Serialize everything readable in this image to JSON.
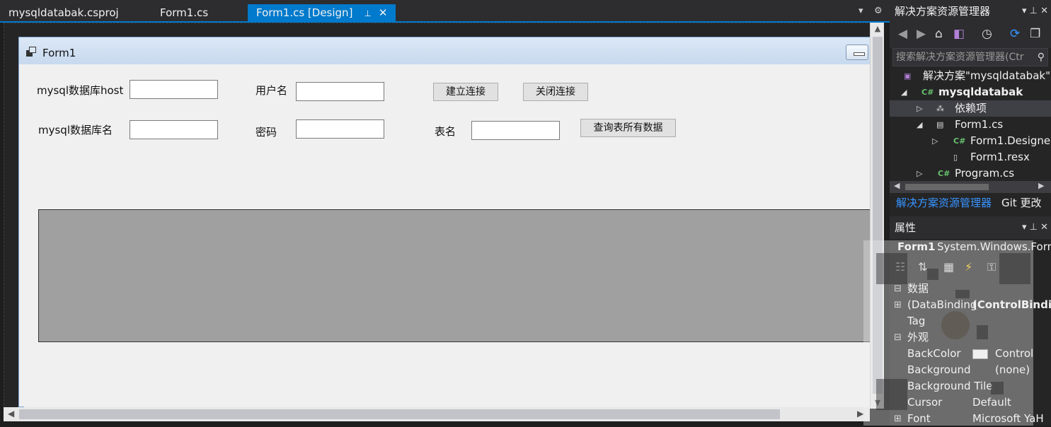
{
  "tabs": [
    {
      "label": "mysqldatabak.csproj",
      "active": false
    },
    {
      "label": "Form1.cs",
      "active": false
    },
    {
      "label": "Form1.cs [Design]",
      "active": true
    }
  ],
  "tab_controls": {
    "pin": "⊥",
    "close": "✕",
    "dropdown": "▾",
    "gear": "⚙"
  },
  "form": {
    "title": "Form1",
    "labels": {
      "host": "mysql数据库host",
      "user": "用户名",
      "dbname": "mysql数据库名",
      "password": "密码",
      "table": "表名"
    },
    "inputs": {
      "host": "",
      "user": "",
      "dbname": "",
      "password": "",
      "table": ""
    },
    "buttons": {
      "connect": "建立连接",
      "disconnect": "关闭连接",
      "query": "查询表所有数据"
    }
  },
  "solution_explorer": {
    "title": "解决方案资源管理器",
    "search_placeholder": "搜索解决方案资源管理器(Ctr",
    "tree": [
      {
        "label": "解决方案\"mysqldatabak\"(",
        "icon": "solution-icon",
        "level": 0
      },
      {
        "label": "mysqldatabak",
        "icon": "csharp-project-icon",
        "level": 0,
        "bold": true,
        "expanded": true
      },
      {
        "label": "依赖项",
        "icon": "dependencies-icon",
        "level": 1,
        "selected": true
      },
      {
        "label": "Form1.cs",
        "icon": "form-icon",
        "level": 1,
        "expanded": true
      },
      {
        "label": "Form1.Designe",
        "icon": "csharp-file-icon",
        "level": 2
      },
      {
        "label": "Form1.resx",
        "icon": "resource-file-icon",
        "level": 2
      },
      {
        "label": "Program.cs",
        "icon": "csharp-file-icon",
        "level": 1
      }
    ],
    "bottom_tabs": [
      "解决方案资源管理器",
      "Git 更改"
    ]
  },
  "properties": {
    "title": "属性",
    "object_name": "Form1",
    "object_type": "System.Windows.Forr",
    "rows": [
      {
        "kind": "category",
        "name": "数据"
      },
      {
        "kind": "prop",
        "name": "(DataBinding",
        "value": "(ControlBindir",
        "expandable": true,
        "bold_value": true
      },
      {
        "kind": "prop",
        "name": "Tag",
        "value": ""
      },
      {
        "kind": "category",
        "name": "外观"
      },
      {
        "kind": "prop",
        "name": "BackColor",
        "value": "Control",
        "swatch": "#f0f0f0"
      },
      {
        "kind": "prop",
        "name": "Background",
        "value": "(none)"
      },
      {
        "kind": "prop",
        "name": "Background Tile",
        "value": ""
      },
      {
        "kind": "prop",
        "name": "Cursor",
        "value": "Default"
      },
      {
        "kind": "prop",
        "name": "Font",
        "value": "Microsoft YaH",
        "expandable": true
      }
    ]
  },
  "colors": {
    "accent": "#007acc",
    "panel_bg": "#252526",
    "form_bg": "#f0f0f0",
    "grid_bg": "#a0a0a0"
  }
}
